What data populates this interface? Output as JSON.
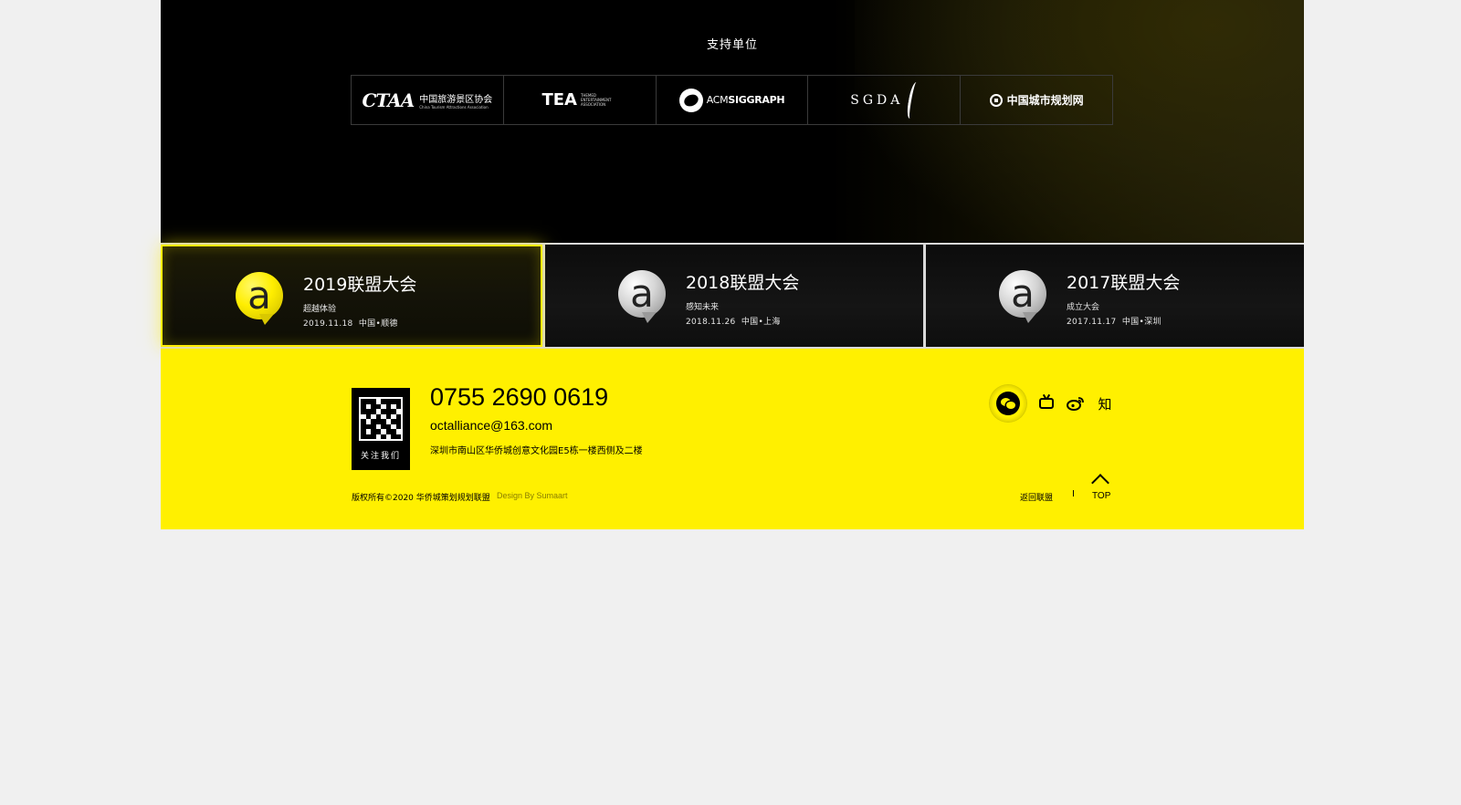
{
  "sponsors": {
    "title": "支持单位",
    "logos": [
      {
        "name": "CTAA",
        "mark": "CTAA",
        "text": "中国旅游景区协会",
        "sub": "China Tourism Attractions Association"
      },
      {
        "name": "TEA",
        "mark": "TEA",
        "sub": "THEMED ENTERTAINMENT ASSOCIATION"
      },
      {
        "name": "ACM SIGGRAPH",
        "mark_light": "ACM",
        "mark_bold": "SIGGRAPH"
      },
      {
        "name": "SGDA",
        "mark": "SGDA"
      },
      {
        "name": "中国城市规划网",
        "text": "中国城市规划网"
      }
    ]
  },
  "conferences": [
    {
      "title": "2019联盟大会",
      "subtitle": "超越体验",
      "date": "2019.11.18",
      "location": "中国•顺德",
      "active": true,
      "icon": "a"
    },
    {
      "title": "2018联盟大会",
      "subtitle": "感知未来",
      "date": "2018.11.26",
      "location": "中国•上海",
      "active": false,
      "icon": "a"
    },
    {
      "title": "2017联盟大会",
      "subtitle": "成立大会",
      "date": "2017.11.17",
      "location": "中国•深圳",
      "active": false,
      "icon": "a"
    }
  ],
  "footer": {
    "qr_label": "关注我们",
    "phone": "0755 2690 0619",
    "email": "octalliance@163.com",
    "address": "深圳市南山区华侨城创意文化园E5栋一楼西侧及二楼",
    "copyright": "版权所有©2020 华侨城策划规划联盟",
    "design_by": "Design By Sumaart",
    "back_link": "返回联盟",
    "separator": "I",
    "top_label": "TOP",
    "social": [
      "wechat-icon",
      "bilibili-icon",
      "weibo-icon",
      "zhihu-icon"
    ],
    "zhihu_glyph": "知"
  },
  "colors": {
    "accent": "#fff000",
    "dark": "#000000",
    "page_bg": "#f0f0f0"
  }
}
